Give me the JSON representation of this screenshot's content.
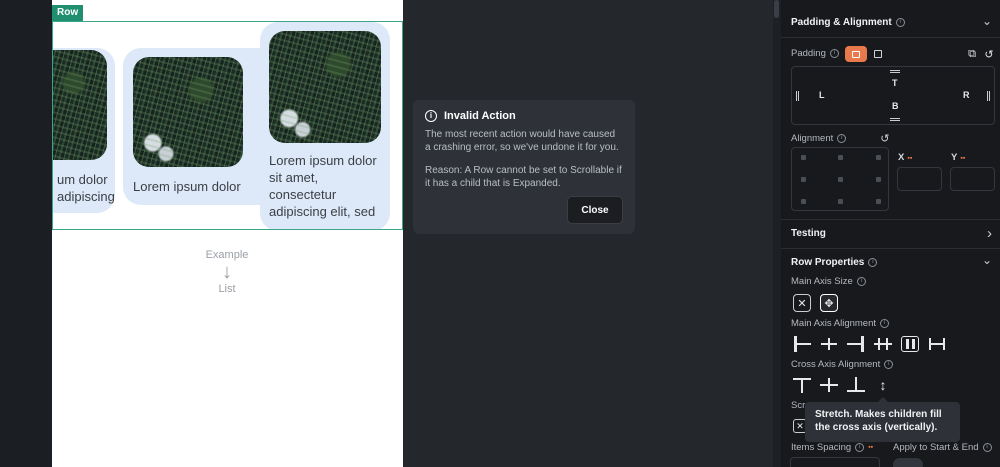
{
  "canvas": {
    "row_tag": "Row",
    "cards": [
      {
        "text": "um dolor\nadipiscing"
      },
      {
        "text": "Lorem ipsum dolor"
      },
      {
        "text": "Lorem ipsum dolor sit amet, consectetur adipiscing elit, sed"
      }
    ],
    "example_top": "Example",
    "example_arrow": "↓",
    "example_bottom": "List"
  },
  "toast": {
    "title": "Invalid Action",
    "message": "The most recent action would have caused a crashing error, so we've undone it for you.",
    "reason": "Reason: A Row cannot be set to Scrollable if it has a child that is Expanded.",
    "close_label": "Close"
  },
  "panel": {
    "padding_alignment": {
      "title": "Padding & Alignment",
      "padding_label": "Padding",
      "top": "T",
      "bottom": "B",
      "left": "L",
      "right": "R",
      "alignment_label": "Alignment",
      "x_label": "X",
      "y_label": "Y",
      "swatch": "▪▪"
    },
    "testing": {
      "title": "Testing",
      "chevron": "›"
    },
    "row_properties": {
      "title": "Row Properties",
      "main_axis_size": "Main Axis Size",
      "main_axis_alignment": "Main Axis Alignment",
      "cross_axis_alignment": "Cross Axis Alignment",
      "scroll_label": "Scro",
      "items_spacing": "Items Spacing",
      "apply_to_start_end": "Apply to Start & End"
    },
    "tooltip": "Stretch. Makes children fill the cross axis (vertically).",
    "chevron_down": "⌄",
    "help": "i"
  },
  "colors": {
    "accent": "#e8794d",
    "row_tag": "#1f8f6f",
    "card_bg": "#dde8f8"
  }
}
